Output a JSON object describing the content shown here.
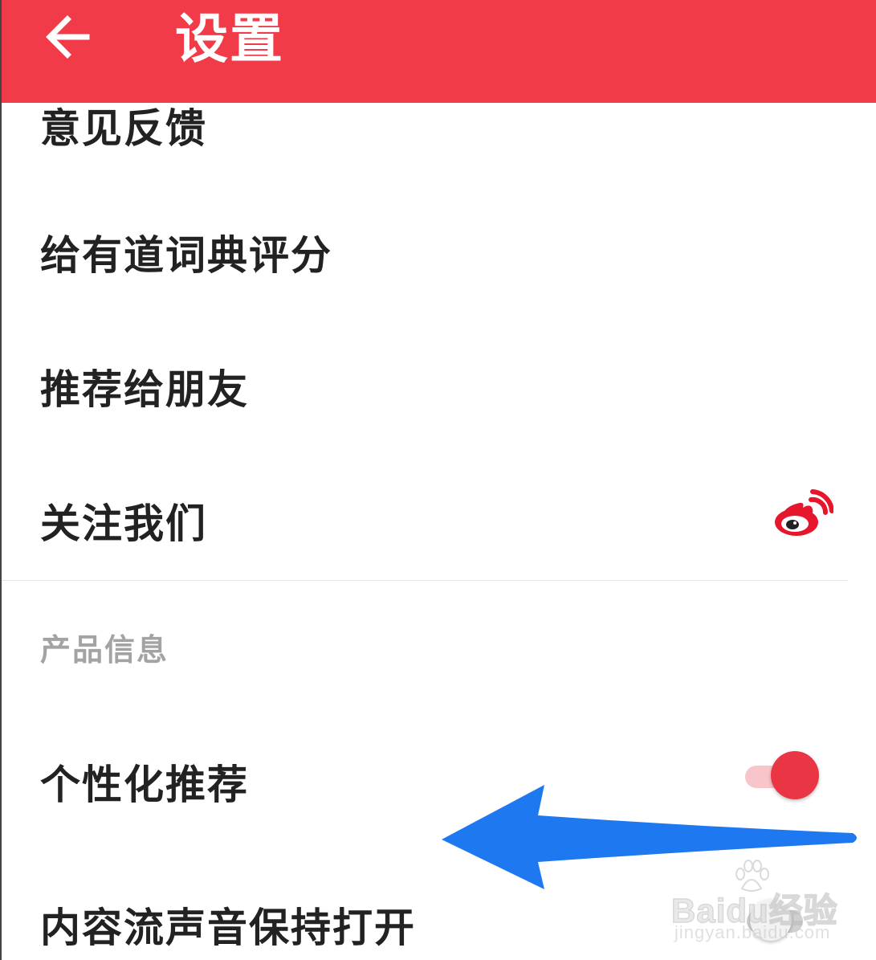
{
  "header": {
    "title": "设置",
    "back_icon": "arrow-left-icon",
    "background_color": "#f23b48"
  },
  "items": {
    "feedback": "意见反馈",
    "rate": "给有道词典评分",
    "share": "推荐给朋友",
    "follow": "关注我们",
    "follow_icon": "weibo-icon"
  },
  "section": {
    "product_info": "产品信息"
  },
  "settings": {
    "personalized_label": "个性化推荐",
    "personalized_on": true,
    "sound_label": "内容流声音保持打开",
    "sound_on": false
  },
  "overlay": {
    "arrow_color": "#1e78f0"
  },
  "watermark": {
    "brand_text": "Baidu经验",
    "domain_text": "jingyan.baidu.com"
  }
}
